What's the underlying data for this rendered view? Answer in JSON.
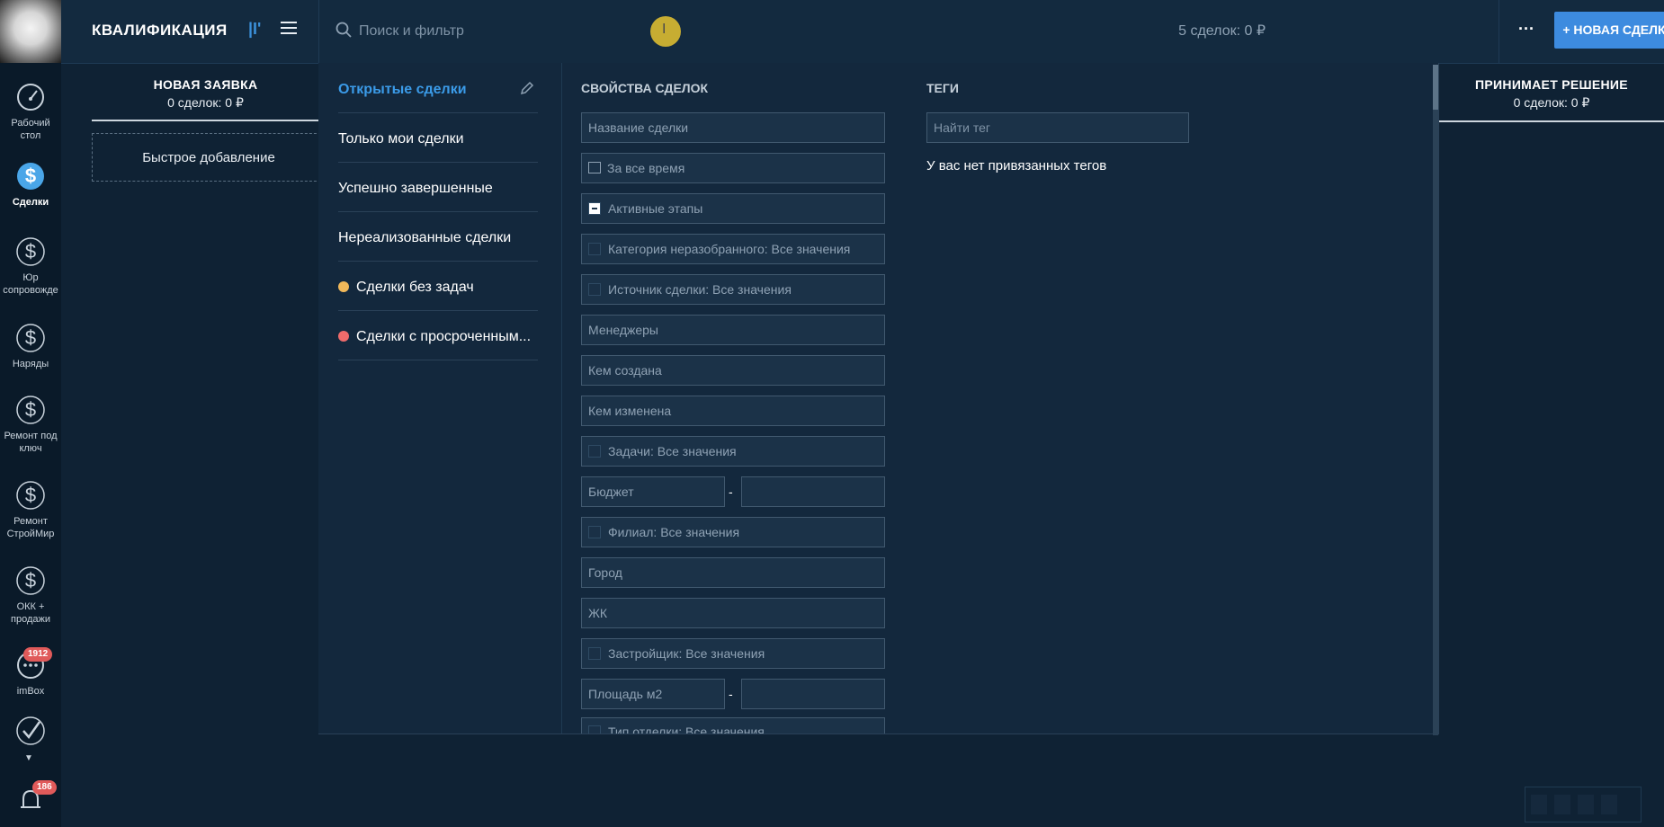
{
  "nav": {
    "items": [
      {
        "label": "Рабочий\nстол",
        "l1": "Рабочий",
        "l2": "стол"
      },
      {
        "l1": "Сделки",
        "l2": ""
      },
      {
        "l1": "Юр",
        "l2": "сопровожде"
      },
      {
        "l1": "Наряды",
        "l2": ""
      },
      {
        "l1": "Ремонт под",
        "l2": "ключ"
      },
      {
        "l1": "Ремонт",
        "l2": "СтройМир"
      },
      {
        "l1": "ОКК +",
        "l2": "продажи"
      },
      {
        "l1": "imBox",
        "l2": "",
        "badge": "1912"
      }
    ],
    "notifications_badge": "186"
  },
  "header": {
    "title": "КВАЛИФИКАЦИЯ",
    "view_toggle": "|I'",
    "search_placeholder": "Поиск и фильтр",
    "summary": "5 сделок: 0 ₽",
    "more": "···",
    "new_deal": "+ НОВАЯ СДЕЛКА"
  },
  "board": {
    "col1_title": "НОВАЯ ЗАЯВКА",
    "col1_summary": "0 сделок: 0 ₽",
    "quick_add": "Быстрое добавление",
    "col_right_title": "ПРИНИМАЕТ РЕШЕНИЕ",
    "col_right_summary": "0 сделок: 0 ₽"
  },
  "filter": {
    "presets": [
      "Открытые сделки",
      "Только мои сделки",
      "Успешно завершенные",
      "Нереализованные сделки",
      "Сделки без задач",
      "Сделки с просроченным..."
    ],
    "presets_dot_colors": [
      "",
      "",
      "",
      "",
      "#f0b85a",
      "#ee6b6b"
    ],
    "props_title": "СВОЙСТВА СДЕЛОК",
    "fields": {
      "deal_name": "Название сделки",
      "period": "За все время",
      "active_stages": "Активные этапы",
      "category": "Категория неразобранного: Все значения",
      "source": "Источник сделки: Все значения",
      "managers": "Менеджеры",
      "created_by": "Кем создана",
      "changed_by": "Кем изменена",
      "tasks": "Задачи: Все значения",
      "budget": "Бюджет",
      "branch": "Филиал: Все значения",
      "city": "Город",
      "zhk": "ЖК",
      "developer": "Застройщик: Все значения",
      "area": "Площадь м2",
      "finish_type": "Тип отделки: Все значения",
      "range_dash": "-"
    },
    "tags_title": "ТЕГИ",
    "tags_placeholder": "Найти тег",
    "no_tags": "У вас нет привязанных тегов"
  }
}
